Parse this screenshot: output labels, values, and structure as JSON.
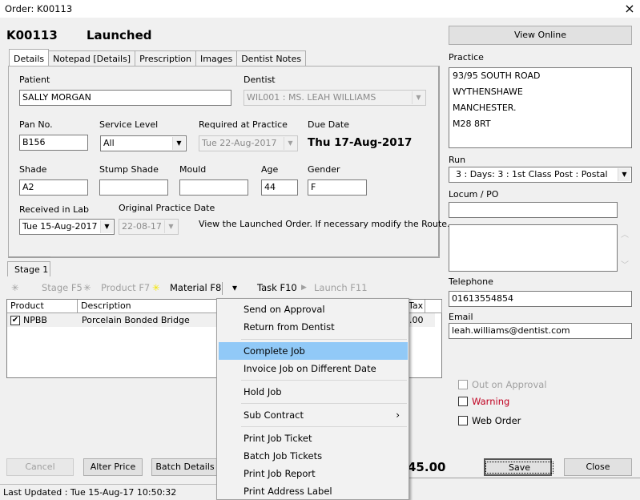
{
  "window": {
    "title": "Order: K00113",
    "close_icon": "×"
  },
  "header": {
    "order_number": "K00113",
    "status": "Launched"
  },
  "tabs": [
    {
      "label": "Details",
      "active": true
    },
    {
      "label": "Notepad [Details]",
      "active": false
    },
    {
      "label": "Prescription",
      "active": false
    },
    {
      "label": "Images",
      "active": false
    },
    {
      "label": "Dentist Notes",
      "active": false
    }
  ],
  "details": {
    "patient": {
      "label": "Patient",
      "value": "SALLY MORGAN"
    },
    "dentist": {
      "label": "Dentist",
      "value": "WIL001 : MS. LEAH WILLIAMS"
    },
    "pan_no": {
      "label": "Pan No.",
      "value": "B156"
    },
    "service_level": {
      "label": "Service Level",
      "value": "All"
    },
    "required_at_practice": {
      "label": "Required at Practice",
      "value": "Tue  22-Aug-2017"
    },
    "due_date": {
      "label": "Due Date",
      "value": "Thu 17-Aug-2017"
    },
    "shade": {
      "label": "Shade",
      "value": "A2"
    },
    "stump_shade": {
      "label": "Stump Shade",
      "value": ""
    },
    "mould": {
      "label": "Mould",
      "value": ""
    },
    "age": {
      "label": "Age",
      "value": "44"
    },
    "gender": {
      "label": "Gender",
      "value": "F"
    },
    "received_in_lab": {
      "label": "Received in Lab",
      "value": "Tue  15-Aug-2017"
    },
    "original_practice_date": {
      "label": "Original Practice Date",
      "value": "22-08-17"
    },
    "hint": "View the Launched Order. If necessary modify the Route."
  },
  "stage_tab": {
    "label": "Stage 1"
  },
  "toolbar": {
    "stage": {
      "icon": "asterisk-icon",
      "label": "Stage F5"
    },
    "product": {
      "icon": "asterisk-icon",
      "label": "Product F7"
    },
    "material": {
      "icon": "asterisk-yellow-icon",
      "label": "Material F8"
    },
    "dropdown_icon": "▾",
    "task": {
      "label": "Task F10"
    },
    "launch": {
      "icon": "play-icon",
      "label": "Launch F11"
    }
  },
  "grid": {
    "columns": [
      "Product",
      "Description",
      "Tax"
    ],
    "rows": [
      {
        "checked": true,
        "product": "NPBB",
        "description": "Porcelain Bonded Bridge",
        "tax": ".00"
      }
    ]
  },
  "context_menu": {
    "items": [
      {
        "label": "Send on Approval"
      },
      {
        "label": "Return from Dentist"
      },
      {
        "label": "Complete Job",
        "highlighted": true
      },
      {
        "label": "Invoice Job on Different Date"
      },
      {
        "label": "Hold Job"
      },
      {
        "label": "Sub Contract",
        "submenu": "›"
      },
      {
        "label": "Print Job Ticket"
      },
      {
        "label": "Batch Job Tickets"
      },
      {
        "label": "Print Job Report"
      },
      {
        "label": "Print Address Label"
      }
    ]
  },
  "buttons": {
    "cancel": "Cancel",
    "alter_price": "Alter Price",
    "batch_details": "Batch Details",
    "save": "Save",
    "close": "Close",
    "view_online": "View Online"
  },
  "total": "£45.00",
  "total_visible": "45.00",
  "status_bar": "Last Updated : Tue 15-Aug-17 10:50:32",
  "right": {
    "practice": {
      "label": "Practice",
      "lines": [
        "93/95 SOUTH ROAD",
        "WYTHENSHAWE",
        "MANCHESTER.",
        "M28 8RT"
      ]
    },
    "run": {
      "label": "Run",
      "value": "3 : Days: 3 : 1st Class Post : Postal"
    },
    "locum_po": {
      "label": "Locum / PO",
      "value": ""
    },
    "notes": "",
    "telephone": {
      "label": "Telephone",
      "value": "01613554854"
    },
    "email": {
      "label": "Email",
      "value": "leah.williams@dentist.com"
    },
    "checkboxes": {
      "out_on_approval": {
        "label": "Out on Approval",
        "checked": false,
        "enabled": false
      },
      "warning": {
        "label": "Warning",
        "checked": false,
        "color": "#c00020"
      },
      "web_order": {
        "label": "Web Order",
        "checked": false
      }
    }
  },
  "colors": {
    "menu_highlight": "#91c9f7",
    "warning": "#c00020",
    "material_star": "#f5e600"
  }
}
